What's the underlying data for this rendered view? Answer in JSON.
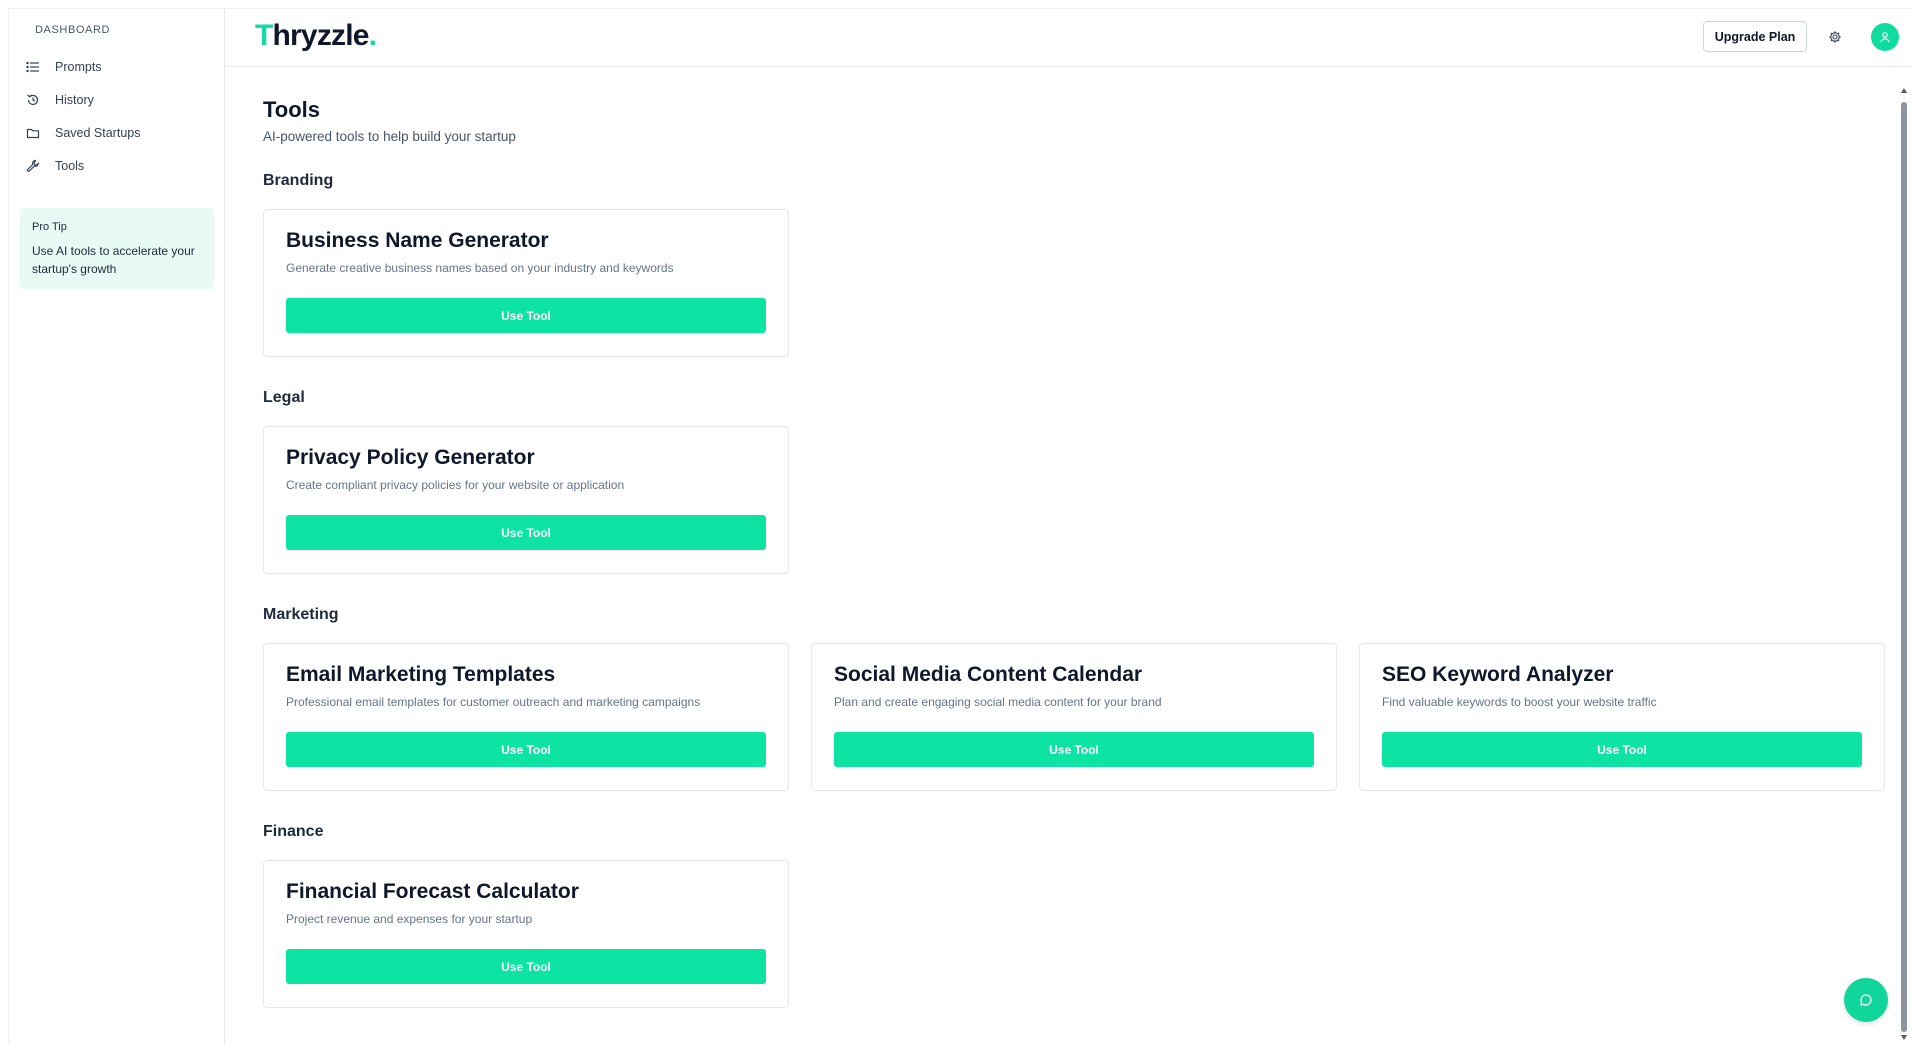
{
  "sidebar": {
    "heading": "DASHBOARD",
    "items": [
      {
        "label": "Prompts",
        "icon": "list-icon"
      },
      {
        "label": "History",
        "icon": "history-icon"
      },
      {
        "label": "Saved Startups",
        "icon": "folder-icon"
      },
      {
        "label": "Tools",
        "icon": "wrench-icon"
      }
    ],
    "pro_tip": {
      "title": "Pro Tip",
      "text": "Use AI tools to accelerate your startup's growth"
    }
  },
  "header": {
    "logo_first": "T",
    "logo_rest": "hryzzle",
    "logo_dot": ".",
    "upgrade_label": "Upgrade Plan",
    "settings_icon": "gear-icon",
    "avatar_icon": "user-icon"
  },
  "page": {
    "title": "Tools",
    "subtitle": "AI-powered tools to help build your startup"
  },
  "sections": [
    {
      "name": "Branding",
      "tools": [
        {
          "title": "Business Name Generator",
          "desc": "Generate creative business names based on your industry and keywords",
          "button": "Use Tool"
        }
      ]
    },
    {
      "name": "Legal",
      "tools": [
        {
          "title": "Privacy Policy Generator",
          "desc": "Create compliant privacy policies for your website or application",
          "button": "Use Tool"
        }
      ]
    },
    {
      "name": "Marketing",
      "tools": [
        {
          "title": "Email Marketing Templates",
          "desc": "Professional email templates for customer outreach and marketing campaigns",
          "button": "Use Tool"
        },
        {
          "title": "Social Media Content Calendar",
          "desc": "Plan and create engaging social media content for your brand",
          "button": "Use Tool"
        },
        {
          "title": "SEO Keyword Analyzer",
          "desc": "Find valuable keywords to boost your website traffic",
          "button": "Use Tool"
        }
      ]
    },
    {
      "name": "Finance",
      "tools": [
        {
          "title": "Financial Forecast Calculator",
          "desc": "Project revenue and expenses for your startup",
          "button": "Use Tool"
        }
      ]
    }
  ],
  "colors": {
    "accent": "#0de3a3",
    "tip_bg": "#e7fbf4"
  },
  "chat_icon": "chat-bubble-icon"
}
